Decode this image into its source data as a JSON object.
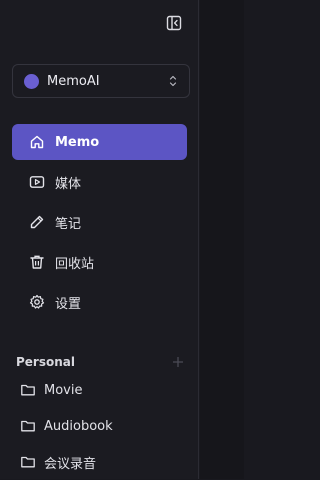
{
  "workspace": {
    "name": "MemoAI",
    "dot_color": "#6a5fd1"
  },
  "nav": {
    "items": [
      {
        "label": "Memo",
        "icon": "home-icon",
        "active": true
      },
      {
        "label": "媒体",
        "icon": "play-icon",
        "active": false
      },
      {
        "label": "笔记",
        "icon": "pencil-icon",
        "active": false
      },
      {
        "label": "回收站",
        "icon": "trash-icon",
        "active": false
      },
      {
        "label": "设置",
        "icon": "gear-icon",
        "active": false
      }
    ]
  },
  "personal": {
    "title": "Personal",
    "folders": [
      {
        "label": "Movie",
        "icon": "folder-icon"
      },
      {
        "label": "Audiobook",
        "icon": "folder-icon"
      },
      {
        "label": "会议录音",
        "icon": "folder-icon"
      }
    ]
  },
  "colors": {
    "accent": "#5c55c4",
    "background": "#1b1b21"
  }
}
